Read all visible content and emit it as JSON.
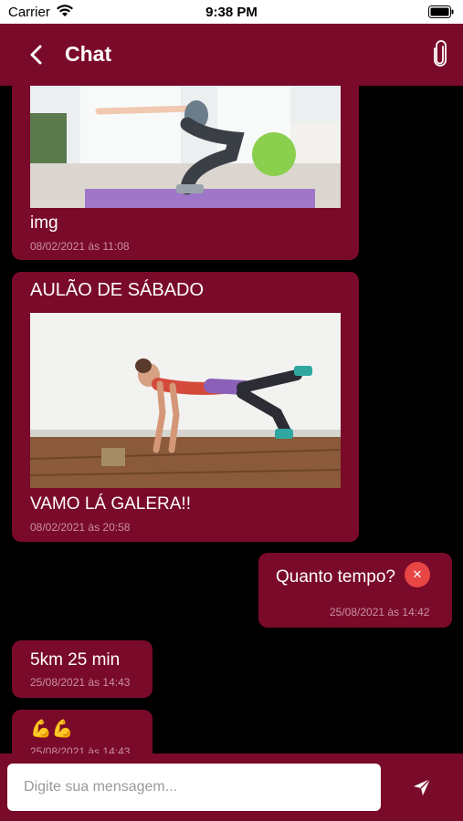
{
  "status_bar": {
    "carrier": "Carrier",
    "time": "9:38 PM"
  },
  "header": {
    "title": "Chat",
    "back_icon": "chevron-left-icon",
    "attach_icon": "paperclip-icon"
  },
  "messages": [
    {
      "text": "img",
      "timestamp": "08/02/2021 às 11:08",
      "image": "workout-squat-photo"
    },
    {
      "title": "AULÃO DE SÁBADO",
      "text": "VAMO LÁ GALERA!!",
      "timestamp": "08/02/2021 às 20:58",
      "image": "workout-plank-photo"
    },
    {
      "text": "Quanto tempo?",
      "timestamp": "25/08/2021 às 14:42",
      "delete_icon": "close-icon"
    },
    {
      "text": "5km 25 min",
      "timestamp": "25/08/2021 às 14:43"
    },
    {
      "text": "💪💪",
      "timestamp": "25/08/2021 às 14:43"
    }
  ],
  "composer": {
    "placeholder": "Digite sua mensagem...",
    "send_icon": "send-icon"
  },
  "colors": {
    "brand": "#7a0a2a",
    "background": "#000000",
    "delete": "#e84545"
  }
}
